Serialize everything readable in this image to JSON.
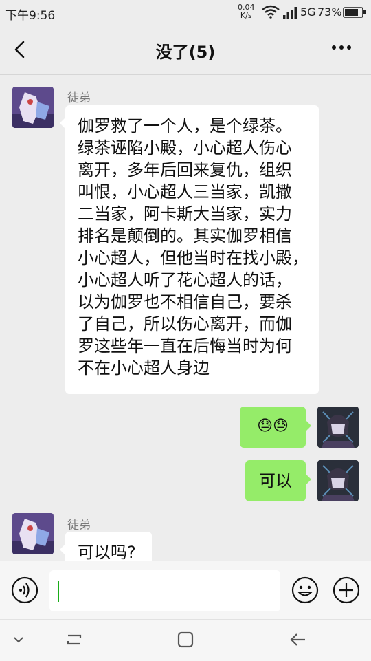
{
  "status_bar": {
    "time": "下午9:56",
    "net_speed_value": "0.04",
    "net_speed_unit": "K/s",
    "network": "5G",
    "battery_percent": "73%"
  },
  "header": {
    "title": "没了(5)",
    "back_icon": "chevron-left-icon",
    "more_icon": "more-icon"
  },
  "messages": [
    {
      "side": "left",
      "sender": "徒弟",
      "text": "伽罗救了一个人，是个绿茶。绿茶诬陷小殿，小心超人伤心离开，多年后回来复仇，组织叫恨，小心超人三当家，凯撒二当家，阿卡斯大当家，实力排名是颠倒的。其实伽罗相信小心超人，但他当时在找小殿，小心超人听了花心超人的话，以为伽罗也不相信自己，要杀了自己，所以伤心离开，而伽罗这些年一直在后悔当时为何不在小心超人身边"
    },
    {
      "side": "right",
      "text": "😓😓"
    },
    {
      "side": "right",
      "text": "可以"
    },
    {
      "side": "left",
      "sender": "徒弟",
      "text": "可以吗?"
    }
  ],
  "message_lines": [
    [
      "伽罗救了一个人，是个绿茶。",
      "绿茶诬陷小殿，小心超人伤心",
      "离开，多年后回来复仇，组织",
      "叫恨，小心超人三当家，凯撒",
      "二当家，阿卡斯大当家，实力",
      "排名是颠倒的。其实伽罗相信",
      "小心超人，但他当时在找小殿，",
      "小心超人听了花心超人的话，",
      "以为伽罗也不相信自己，要杀",
      "了自己，所以伤心离开，而伽",
      "罗这些年一直在后悔当时为何",
      "不在小心超人身边"
    ]
  ],
  "input_bar": {
    "text_value": "",
    "voice_icon": "voice-icon",
    "emoji_icon": "emoji-icon",
    "plus_icon": "plus-icon"
  },
  "colors": {
    "background": "#ededed",
    "incoming_bubble": "#ffffff",
    "outgoing_bubble": "#95ec69",
    "caret": "#1aad19"
  }
}
